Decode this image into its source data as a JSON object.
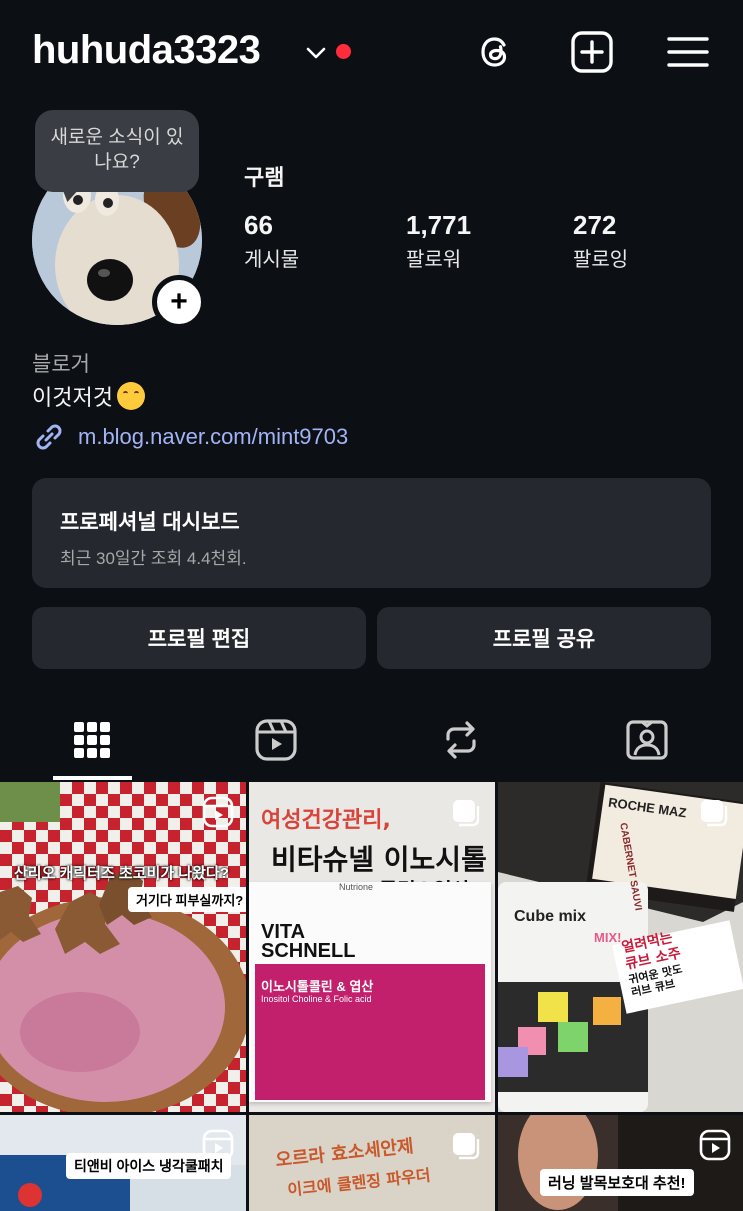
{
  "header": {
    "username": "huhuda3323",
    "icons": [
      "chevron-down-icon",
      "threads-icon",
      "create-post-icon",
      "menu-icon"
    ],
    "notification_color": "#ff2d3b"
  },
  "profile": {
    "note_bubble": "새로운 소식이 있나요?",
    "name": "구램",
    "stats": [
      {
        "value": "66",
        "label": "게시물"
      },
      {
        "value": "1,771",
        "label": "팔로워"
      },
      {
        "value": "272",
        "label": "팔로잉"
      }
    ],
    "category": "블로거",
    "bio": "이것저것",
    "link": "m.blog.naver.com/mint9703"
  },
  "dashboard": {
    "title": "프로페셔널 대시보드",
    "subtitle": "최근 30일간 조회 4.4천회."
  },
  "buttons": {
    "edit_profile": "프로필 편집",
    "share_profile": "프로필 공유"
  },
  "tabs": [
    "grid-icon",
    "reels-icon",
    "reposts-icon",
    "tagged-icon"
  ],
  "posts": [
    {
      "type": "reel",
      "caption": "산리오 캐릭터즈 초코비가 나왔다?",
      "subcaption": "거기다 피부실까지?"
    },
    {
      "type": "carousel",
      "handwritten_1": "여성건강관리,",
      "handwritten_2": "비타슈넬 이노시톨",
      "handwritten_3": "콜린&엽산",
      "product_brand": "Nutrione",
      "product_name_1": "VITA",
      "product_name_2": "SCHNELL",
      "product_desc": "이노시톨콜린 & 엽산",
      "product_desc_en": "Inositol Choline & Folic acid"
    },
    {
      "type": "carousel",
      "label_top": "ROCHE MAZ",
      "label_wine": "CABERNET SAUVI",
      "package_text": "Cube mix",
      "package_sub": "MIX!",
      "note_1": "얼려먹는",
      "note_2": "큐브 소주",
      "note_3": "귀여운 맛도",
      "note_4": "러브 큐브"
    },
    {
      "type": "reel",
      "caption": "티앤비 아이스 냉각쿨패치"
    },
    {
      "type": "carousel",
      "handwritten_1": "오르라 효소세안제",
      "handwritten_2": "이크에 클렌징 파우더"
    },
    {
      "type": "reel",
      "caption": "러닝 발목보호대 추천!"
    }
  ]
}
